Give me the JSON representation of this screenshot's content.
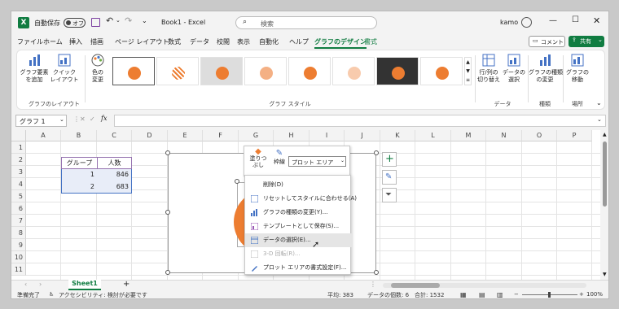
{
  "titlebar": {
    "autosave_label": "自動保存",
    "autosave_state": "オフ",
    "filename": "Book1 - Excel",
    "search_placeholder": "検索",
    "user": "kamo"
  },
  "menu": {
    "items": [
      "ファイル",
      "ホーム",
      "挿入",
      "描画",
      "ページ レイアウト",
      "数式",
      "データ",
      "校閲",
      "表示",
      "自動化",
      "ヘルプ",
      "グラフのデザイン",
      "書式"
    ],
    "active_index": 11,
    "comment_button": "コメント",
    "share_button": "共有"
  },
  "ribbon": {
    "add_element": "グラフ要素\nを追加",
    "quick_layout": "クイック\nレイアウト",
    "change_color": "色の\n変更",
    "group_layout": "グラフのレイアウト",
    "group_styles": "グラフ スタイル",
    "swap_rowcol": "行/列の\n切り替え",
    "select_data": "データの\n選択",
    "group_data": "データ",
    "change_type": "グラフの種類\nの変更",
    "group_type": "種類",
    "move_chart": "グラフの\n移動",
    "group_location": "場所"
  },
  "formula": {
    "namebox": "グラフ 1",
    "fx": "fx"
  },
  "grid": {
    "columns": [
      "A",
      "B",
      "C",
      "D",
      "E",
      "F",
      "G",
      "H",
      "I",
      "J",
      "K",
      "L",
      "M",
      "N",
      "O",
      "P"
    ],
    "rows": [
      "1",
      "2",
      "3",
      "4",
      "5",
      "6",
      "7",
      "8",
      "9",
      "10",
      "11"
    ],
    "table_header": [
      "グループ",
      "人数"
    ],
    "table_rows": [
      [
        "1",
        "846"
      ],
      [
        "2",
        "683"
      ]
    ]
  },
  "minitoolbar": {
    "fill": "塗りつ\nぶし",
    "outline": "枠線",
    "dropdown": "プロット エリア"
  },
  "context_menu": {
    "items": [
      {
        "label": "削除(D)",
        "icon": "none",
        "enabled": true
      },
      {
        "label": "リセットしてスタイルに合わせる(A)",
        "icon": "reset-style-icon",
        "enabled": true
      },
      {
        "label": "グラフの種類の変更(Y)...",
        "icon": "chart-type-icon",
        "enabled": true
      },
      {
        "label": "テンプレートとして保存(S)...",
        "icon": "template-icon",
        "enabled": true
      },
      {
        "label": "データの選択(E)...",
        "icon": "select-data-icon",
        "enabled": true
      },
      {
        "label": "3-D 回転(R)...",
        "icon": "rotate-3d-icon",
        "enabled": false
      },
      {
        "label": "プロット エリアの書式設定(F)...",
        "icon": "format-icon",
        "enabled": true
      }
    ],
    "hovered_index": 4
  },
  "sheets": {
    "tabs": [
      "Sheet1"
    ]
  },
  "status": {
    "ready": "準備完了",
    "accessibility": "アクセシビリティ: 検討が必要です",
    "average": "平均: 383",
    "count": "データの個数: 6",
    "sum": "合計: 1532",
    "zoom": "100%"
  },
  "colors": {
    "accent": "#107c41",
    "orange": "#ed7d31",
    "share_bg": "#107c41"
  }
}
